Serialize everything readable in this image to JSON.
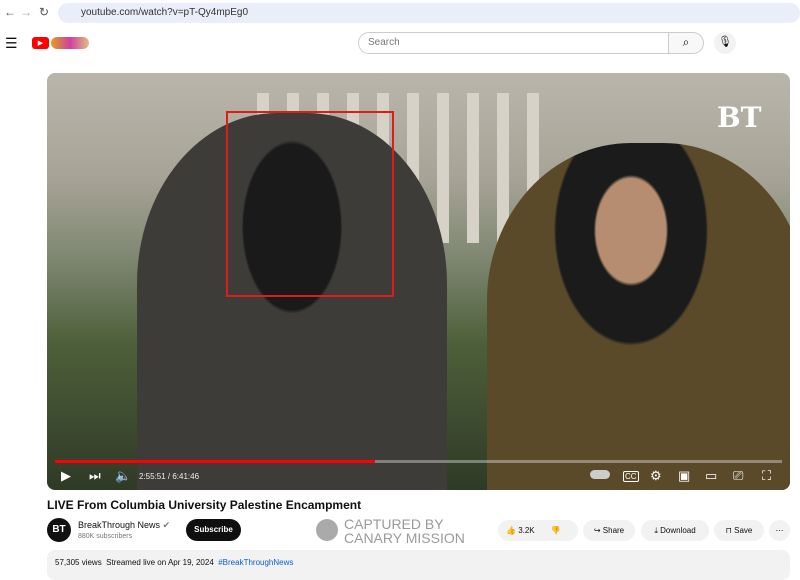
{
  "browser": {
    "url": "youtube.com/watch?v=pT-Qy4mpEg0"
  },
  "header": {
    "search_placeholder": "Search"
  },
  "player": {
    "current_time": "2:55:51",
    "duration": "6:41:46",
    "time_display": "2:55:51 / 6:41:46",
    "progress_percent": 44,
    "logo": "BT"
  },
  "video": {
    "title": "LIVE From Columbia University Palestine Encampment",
    "channel": "BreakThrough News",
    "subscribers": "880K subscribers",
    "subscribe_label": "Subscribe",
    "likes": "3.2K",
    "share_label": "Share",
    "download_label": "Download",
    "save_label": "Save",
    "views": "57,305 views",
    "streamed": "Streamed live on Apr 19, 2024",
    "hashtag": "#BreakThroughNews"
  },
  "watermark": {
    "line1": "CAPTURED BY",
    "line2": "CANARY MISSION"
  },
  "colors": {
    "accent": "#ff0000",
    "highlight_box": "#e01b1b"
  }
}
